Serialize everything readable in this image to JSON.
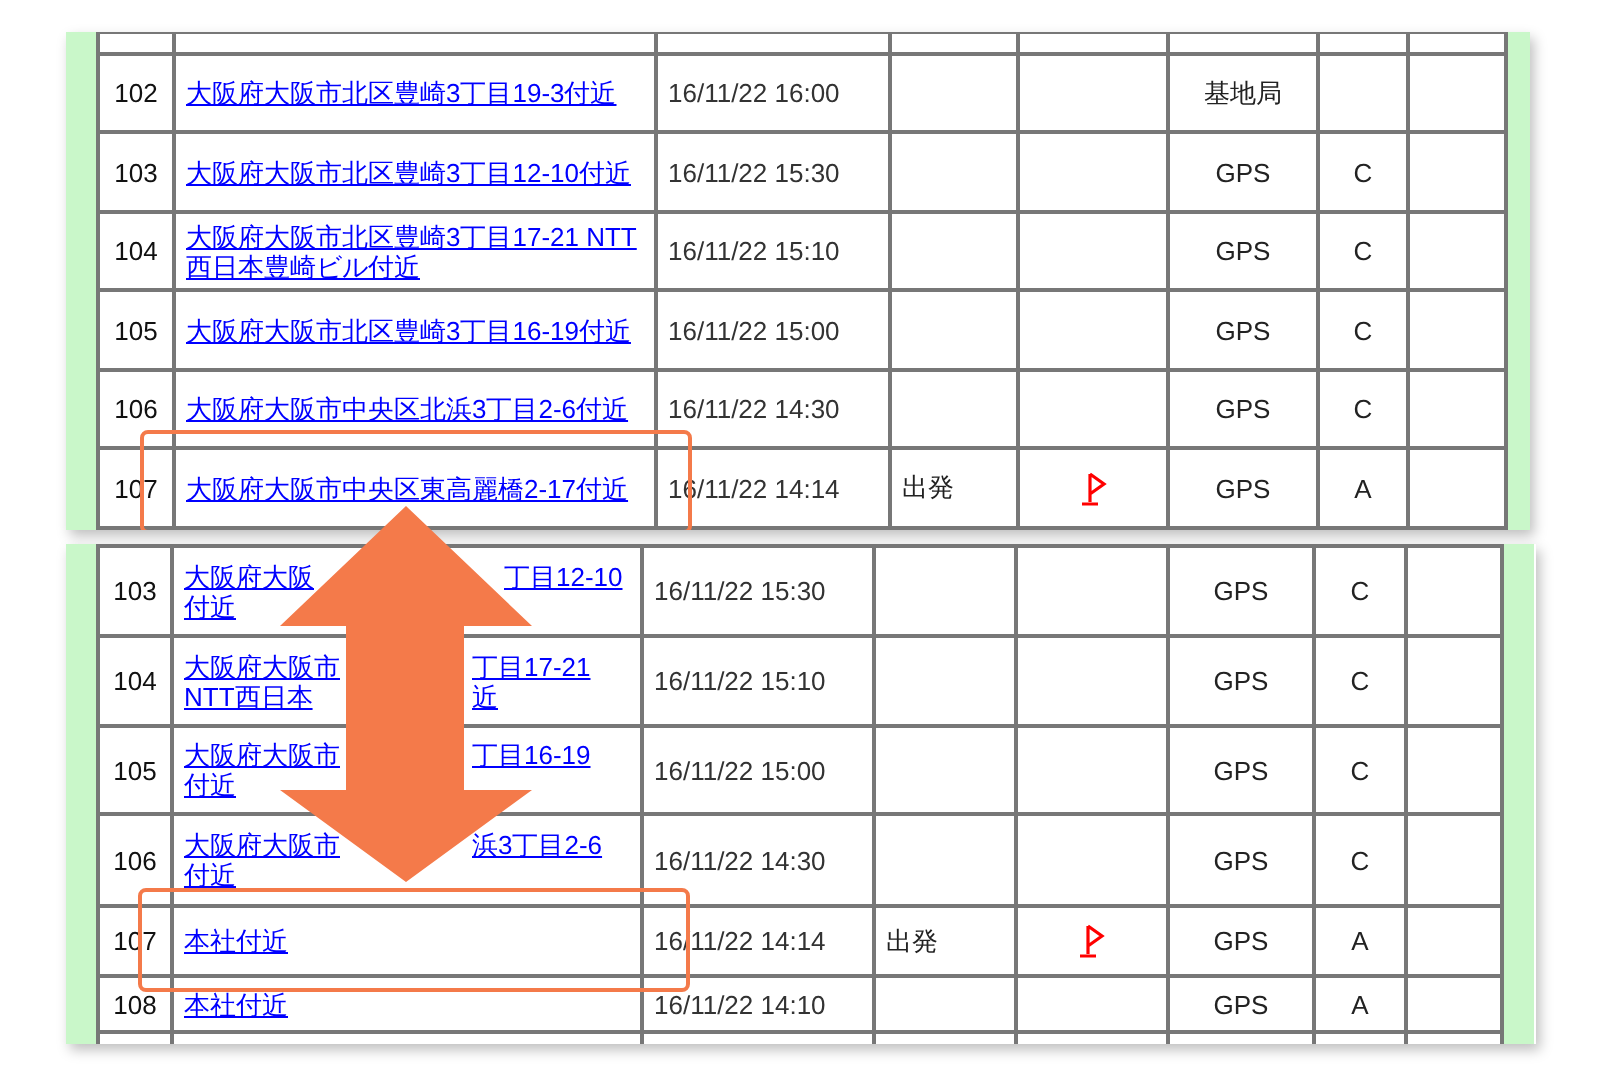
{
  "top_table": {
    "rows": [
      {
        "no": "102",
        "address": "大阪府大阪市北区豊崎3丁目19-3付近",
        "time": "16/11/22 16:00",
        "status": "",
        "flag": false,
        "method": "基地局",
        "grade": "",
        "highlighted": false
      },
      {
        "no": "103",
        "address": "大阪府大阪市北区豊崎3丁目12-10付近",
        "time": "16/11/22 15:30",
        "status": "",
        "flag": false,
        "method": "GPS",
        "grade": "C",
        "highlighted": false
      },
      {
        "no": "104",
        "address": "大阪府大阪市北区豊崎3丁目17-21 NTT西日本豊崎ビル付近",
        "time": "16/11/22 15:10",
        "status": "",
        "flag": false,
        "method": "GPS",
        "grade": "C",
        "highlighted": false
      },
      {
        "no": "105",
        "address": "大阪府大阪市北区豊崎3丁目16-19付近",
        "time": "16/11/22 15:00",
        "status": "",
        "flag": false,
        "method": "GPS",
        "grade": "C",
        "highlighted": false
      },
      {
        "no": "106",
        "address": "大阪府大阪市中央区北浜3丁目2-6付近",
        "time": "16/11/22 14:30",
        "status": "",
        "flag": false,
        "method": "GPS",
        "grade": "C",
        "highlighted": false
      },
      {
        "no": "107",
        "address": "大阪府大阪市中央区東高麗橋2-17付近",
        "time": "16/11/22 14:14",
        "status": "出発",
        "flag": true,
        "method": "GPS",
        "grade": "A",
        "highlighted": true
      }
    ]
  },
  "bottom_table": {
    "rows": [
      {
        "no": "103",
        "address_lines": [
          [
            "大阪府大阪",
            "丁目12-10"
          ],
          [
            "付近"
          ]
        ],
        "time": "16/11/22 15:30",
        "status": "",
        "flag": false,
        "method": "GPS",
        "grade": "C",
        "highlighted": false
      },
      {
        "no": "104",
        "address_lines": [
          [
            "大阪府大阪市",
            "丁目17-21"
          ],
          [
            "NTT西日本",
            "近"
          ]
        ],
        "time": "16/11/22 15:10",
        "status": "",
        "flag": false,
        "method": "GPS",
        "grade": "C",
        "highlighted": false
      },
      {
        "no": "105",
        "address_lines": [
          [
            "大阪府大阪市",
            "丁目16-19"
          ],
          [
            "付近"
          ]
        ],
        "time": "16/11/22 15:00",
        "status": "",
        "flag": false,
        "method": "GPS",
        "grade": "C",
        "highlighted": false
      },
      {
        "no": "106",
        "address_lines": [
          [
            "大阪府大阪市",
            "浜3丁目2-6"
          ],
          [
            "付近"
          ]
        ],
        "time": "16/11/22 14:30",
        "status": "",
        "flag": false,
        "method": "GPS",
        "grade": "C",
        "highlighted": false
      },
      {
        "no": "107",
        "address_lines": [
          [
            "本社付近"
          ]
        ],
        "time": "16/11/22 14:14",
        "status": "出発",
        "flag": true,
        "method": "GPS",
        "grade": "A",
        "highlighted": true
      },
      {
        "no": "108",
        "address_lines": [
          [
            "本社付近"
          ]
        ],
        "time": "16/11/22 14:10",
        "status": "",
        "flag": false,
        "method": "GPS",
        "grade": "A",
        "highlighted": false
      }
    ]
  }
}
